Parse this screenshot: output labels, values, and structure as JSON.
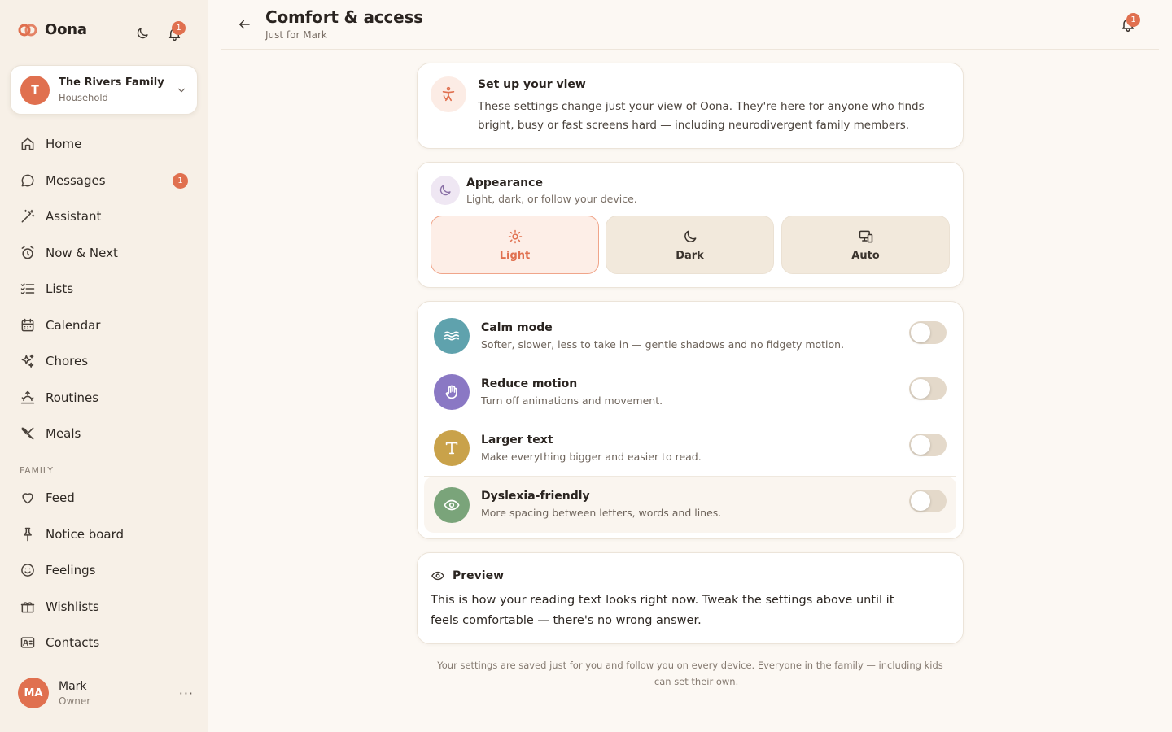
{
  "brand": {
    "name": "Oona",
    "accent": "#e0704f"
  },
  "sidebar": {
    "notifications_count": "1",
    "household": {
      "initial": "T",
      "name": "The Rivers Family",
      "type": "Household"
    },
    "nav": [
      {
        "label": "Home",
        "icon": "home-icon"
      },
      {
        "label": "Messages",
        "icon": "message-icon",
        "badge": "1"
      },
      {
        "label": "Assistant",
        "icon": "magic-wand-icon"
      },
      {
        "label": "Now & Next",
        "icon": "alarm-clock-icon"
      },
      {
        "label": "Lists",
        "icon": "checklist-icon"
      },
      {
        "label": "Calendar",
        "icon": "calendar-icon"
      },
      {
        "label": "Chores",
        "icon": "sparkles-icon"
      },
      {
        "label": "Routines",
        "icon": "sunrise-icon"
      },
      {
        "label": "Meals",
        "icon": "utensils-icon"
      }
    ],
    "family_label": "FAMILY",
    "family_nav": [
      {
        "label": "Feed",
        "icon": "heart-icon"
      },
      {
        "label": "Notice board",
        "icon": "pin-icon"
      },
      {
        "label": "Feelings",
        "icon": "smiley-icon"
      },
      {
        "label": "Wishlists",
        "icon": "gift-icon"
      },
      {
        "label": "Contacts",
        "icon": "contact-card-icon"
      }
    ],
    "user": {
      "initials": "MA",
      "name": "Mark",
      "role": "Owner",
      "more": "···"
    }
  },
  "header": {
    "title": "Comfort & access",
    "subtitle": "Just for Mark",
    "notifications_count": "1"
  },
  "setup": {
    "title": "Set up your view",
    "body": "These settings change just your view of Oona. They're here for anyone who finds bright, busy or fast screens hard — including neurodivergent family members."
  },
  "appearance": {
    "title": "Appearance",
    "subtitle": "Light, dark, or follow your device.",
    "options": [
      {
        "label": "Light",
        "icon": "sun-icon",
        "selected": true
      },
      {
        "label": "Dark",
        "icon": "moon-icon",
        "selected": false
      },
      {
        "label": "Auto",
        "icon": "devices-icon",
        "selected": false
      }
    ]
  },
  "toggles": [
    {
      "title": "Calm mode",
      "desc": "Softer, slower, less to take in — gentle shadows and no fidgety motion.",
      "icon": "waves-icon",
      "color": "#5fa2ad",
      "on": false
    },
    {
      "title": "Reduce motion",
      "desc": "Turn off animations and movement.",
      "icon": "hand-icon",
      "color": "#8a78c4",
      "on": false
    },
    {
      "title": "Larger text",
      "desc": "Make everything bigger and easier to read.",
      "icon": "text-size-icon",
      "color": "#c9a24a",
      "on": false
    },
    {
      "title": "Dyslexia-friendly",
      "desc": "More spacing between letters, words and lines.",
      "icon": "eye-icon",
      "color": "#7aa47a",
      "on": false
    }
  ],
  "preview": {
    "title": "Preview",
    "body": "This is how your reading text looks right now. Tweak the settings above until it feels comfortable — there's no wrong answer."
  },
  "footer": {
    "note": "Your settings are saved just for you and follow you on every device. Everyone in the family — including kids — can set their own."
  }
}
